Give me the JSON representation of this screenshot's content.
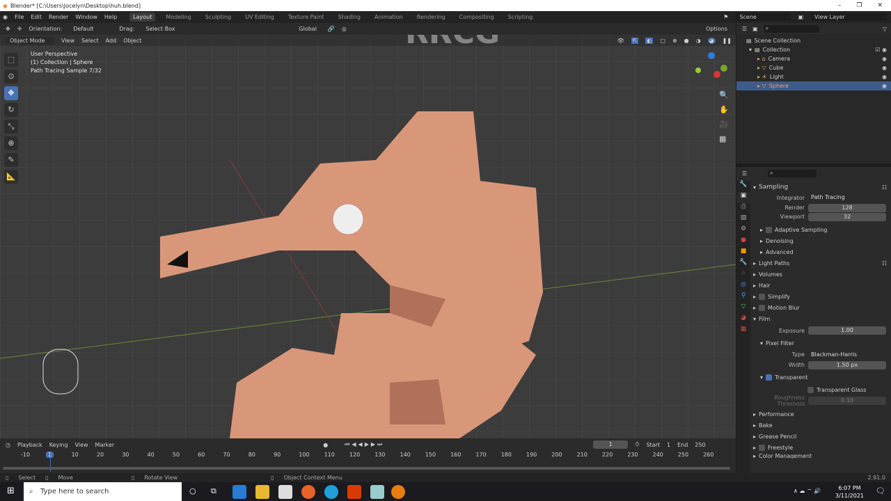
{
  "window": {
    "title": "Blender* [C:\\Users\\Jocelyn\\Desktop\\huh.blend]",
    "controls": [
      "–",
      "❐",
      "✕"
    ]
  },
  "menu": [
    "File",
    "Edit",
    "Render",
    "Window",
    "Help"
  ],
  "workspaces": [
    "Layout",
    "Modeling",
    "Sculpting",
    "UV Editing",
    "Texture Paint",
    "Shading",
    "Animation",
    "Rendering",
    "Compositing",
    "Scripting"
  ],
  "active_workspace": "Layout",
  "scene": {
    "scene_name": "Scene",
    "view_layer": "View Layer"
  },
  "toolheader": {
    "orientation_label": "Orientation:",
    "orientation_value": "Default",
    "drag_label": "Drag:",
    "drag_value": "Select Box",
    "transform_orientation": "Global",
    "options": "Options"
  },
  "viewport_header": {
    "mode": "Object Mode",
    "menus": [
      "View",
      "Select",
      "Add",
      "Object"
    ]
  },
  "viewport_overlay": {
    "line1": "User Perspective",
    "line2": "(1) Collection | Sphere",
    "line3": "Path Tracing Sample 7/32"
  },
  "outliner": {
    "root": "Scene Collection",
    "collection": "Collection",
    "items": [
      {
        "name": "Camera",
        "selected": false
      },
      {
        "name": "Cube",
        "selected": false
      },
      {
        "name": "Light",
        "selected": false
      },
      {
        "name": "Sphere",
        "selected": true
      }
    ]
  },
  "properties": {
    "sampling": {
      "title": "Sampling",
      "integrator_label": "Integrator",
      "integrator": "Path Tracing",
      "render_label": "Render",
      "render": "128",
      "viewport_label": "Viewport",
      "viewport": "32",
      "sub": [
        "Adaptive Sampling",
        "Denoising",
        "Advanced"
      ]
    },
    "panels_a": [
      "Light Paths",
      "Volumes",
      "Hair",
      "Simplify",
      "Motion Blur"
    ],
    "film": {
      "title": "Film",
      "exposure_label": "Exposure",
      "exposure": "1.00",
      "pixel_filter": "Pixel Filter",
      "type_label": "Type",
      "type": "Blackman-Harris",
      "width_label": "Width",
      "width": "1.50 px",
      "transparent": "Transparent",
      "transparent_checked": true,
      "transparent_glass": "Transparent Glass",
      "roughness_label": "Roughness Threshold",
      "roughness": "0.10"
    },
    "panels_b": [
      "Performance",
      "Bake",
      "Grease Pencil",
      "Freestyle",
      "Color Management"
    ]
  },
  "timeline": {
    "menus": [
      "Playback",
      "Keying",
      "View",
      "Marker"
    ],
    "current_frame": "1",
    "start_label": "Start",
    "start": "1",
    "end_label": "End",
    "end": "250",
    "ticks": [
      "-10",
      "1",
      "10",
      "20",
      "30",
      "40",
      "50",
      "60",
      "70",
      "80",
      "90",
      "100",
      "110",
      "120",
      "130",
      "140",
      "150",
      "160",
      "170",
      "180",
      "190",
      "200",
      "210",
      "220",
      "230",
      "240",
      "250",
      "260"
    ]
  },
  "statusbar": {
    "select": "Select",
    "move": "Move",
    "rotate": "Rotate View",
    "context": "Object Context Menu",
    "version": "2.91.0"
  },
  "taskbar": {
    "search_placeholder": "Type here to search",
    "time": "6:07 PM",
    "date": "3/11/2021"
  },
  "watermark": "RRCG"
}
